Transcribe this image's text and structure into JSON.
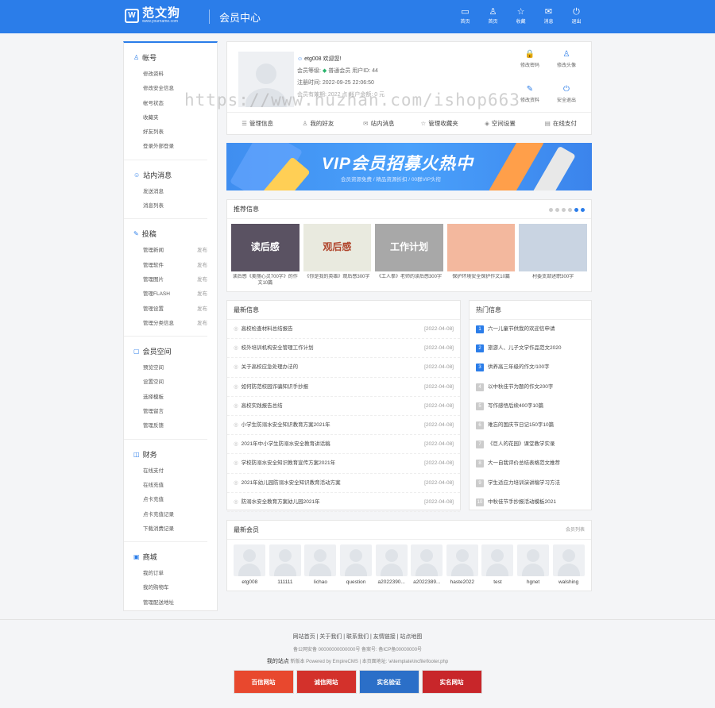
{
  "header": {
    "logo_mark": "W",
    "site_name": "范文狗",
    "site_url": "www.yourname.com",
    "page_title": "会员中心",
    "nav": [
      {
        "icon": "monitor-icon",
        "glyph": "▭",
        "label": "首页"
      },
      {
        "icon": "user-icon",
        "glyph": "♙",
        "label": "首页"
      },
      {
        "icon": "star-icon",
        "glyph": "☆",
        "label": "收藏"
      },
      {
        "icon": "mail-icon",
        "glyph": "✉",
        "label": "消息"
      },
      {
        "icon": "power-icon",
        "glyph": "⏻",
        "label": "退出"
      }
    ]
  },
  "sidebar": [
    {
      "title": "帐号",
      "icon": "user-icon",
      "glyph": "♙",
      "items": [
        {
          "label": "修改资料",
          "action": ""
        },
        {
          "label": "修改安全信息",
          "action": ""
        },
        {
          "label": "帐号状态",
          "action": ""
        },
        {
          "label": "收藏夹",
          "action": ""
        },
        {
          "label": "好友列表",
          "action": ""
        },
        {
          "label": "登录外部登录",
          "action": ""
        }
      ]
    },
    {
      "title": "站内消息",
      "icon": "message-icon",
      "glyph": "☺",
      "items": [
        {
          "label": "发送消息",
          "action": ""
        },
        {
          "label": "消息列表",
          "action": ""
        }
      ]
    },
    {
      "title": "投稿",
      "icon": "pen-icon",
      "glyph": "✎",
      "items": [
        {
          "label": "管理新闻",
          "action": "发布"
        },
        {
          "label": "管理软件",
          "action": "发布"
        },
        {
          "label": "管理图片",
          "action": "发布"
        },
        {
          "label": "管理FLASH",
          "action": "发布"
        },
        {
          "label": "管理设置",
          "action": "发布"
        },
        {
          "label": "管理分类信息",
          "action": "发布"
        }
      ]
    },
    {
      "title": "会员空间",
      "icon": "space-icon",
      "glyph": "▢",
      "items": [
        {
          "label": "预览空间",
          "action": ""
        },
        {
          "label": "设置空间",
          "action": ""
        },
        {
          "label": "选择模板",
          "action": ""
        },
        {
          "label": "管理留言",
          "action": ""
        },
        {
          "label": "管理反馈",
          "action": ""
        }
      ]
    },
    {
      "title": "财务",
      "icon": "wallet-icon",
      "glyph": "◫",
      "items": [
        {
          "label": "在线支付",
          "action": ""
        },
        {
          "label": "在线充值",
          "action": ""
        },
        {
          "label": "点卡充值",
          "action": ""
        },
        {
          "label": "点卡充值记录",
          "action": ""
        },
        {
          "label": "下载消费记录",
          "action": ""
        }
      ]
    },
    {
      "title": "商城",
      "icon": "shop-icon",
      "glyph": "▣",
      "items": [
        {
          "label": "我的订单",
          "action": ""
        },
        {
          "label": "我的购物车",
          "action": ""
        },
        {
          "label": "管理配送地址",
          "action": ""
        }
      ]
    }
  ],
  "profile": {
    "username": "etg008 欢迎您!",
    "level_label": "会员等级:",
    "level": "普通会员",
    "uid": "用户ID: 44",
    "reg_time": "注册时间: 2022-09-25 22:06:50",
    "extra": "会员有效期: 2022 点  帐户余额: 0 元",
    "actions": [
      {
        "icon": "lock-icon",
        "glyph": "🔒",
        "label": "修改密码"
      },
      {
        "icon": "user-edit-icon",
        "glyph": "♙",
        "label": "修改头像"
      },
      {
        "icon": "edit-icon",
        "glyph": "✎",
        "label": "修改资料"
      },
      {
        "icon": "logout-icon",
        "glyph": "⏻",
        "label": "安全退出"
      }
    ],
    "tabs": [
      {
        "icon": "list-icon",
        "glyph": "☰",
        "label": "管理信息"
      },
      {
        "icon": "friends-icon",
        "glyph": "♙",
        "label": "我的好友"
      },
      {
        "icon": "inbox-icon",
        "glyph": "✉",
        "label": "站内消息"
      },
      {
        "icon": "favorite-icon",
        "glyph": "☆",
        "label": "管理收藏夹"
      },
      {
        "icon": "cube-icon",
        "glyph": "◈",
        "label": "空间设置"
      },
      {
        "icon": "cart-icon",
        "glyph": "▤",
        "label": "在线支付"
      }
    ]
  },
  "banner": {
    "title": "VIP会员招募火热中",
    "subtitle": "会员资源免费 / 精品资源折扣 / 00群VIP头衔"
  },
  "recommend": {
    "title": "推荐信息",
    "items": [
      {
        "img_text": "读后感",
        "caption": "读后感《美丽心灵700字》的作文10篇",
        "bg": "#5a5262",
        "fg": "#fff"
      },
      {
        "img_text": "观后感",
        "caption": "《你是我的英雄》观后感300字",
        "bg": "#e9eadf",
        "fg": "#b0452c"
      },
      {
        "img_text": "工作计划",
        "caption": "《工人拳》老师的读后感300字",
        "bg": "#a8a8a8",
        "fg": "#fff"
      },
      {
        "img_text": "",
        "caption": "保护环境安全保护作文10篇",
        "bg": "#f3b89e",
        "fg": "#fff"
      },
      {
        "img_text": "",
        "caption": "村委支部述职300字",
        "bg": "#c9d4e2",
        "fg": "#fff"
      }
    ]
  },
  "latest": {
    "title": "最新信息",
    "items": [
      {
        "t": "高校检查材料总结报告",
        "d": "[2022-04-08]"
      },
      {
        "t": "校外培训机构安全管理工作计划",
        "d": "[2022-04-08]"
      },
      {
        "t": "关于高校应急处理办法的",
        "d": "[2022-04-08]"
      },
      {
        "t": "如何防范校园诈骗知识手抄报",
        "d": "[2022-04-08]"
      },
      {
        "t": "高校实践报告总结",
        "d": "[2022-04-08]"
      },
      {
        "t": "小学生防溺水安全知识教育方案2021年",
        "d": "[2022-04-08]"
      },
      {
        "t": "2021年中小学生防溺水安全教育讲话稿",
        "d": "[2022-04-08]"
      },
      {
        "t": "学校防溺水安全知识教育宣传方案2021年",
        "d": "[2022-04-08]"
      },
      {
        "t": "2021年幼儿园防溺水安全知识教育活动方案",
        "d": "[2022-04-08]"
      },
      {
        "t": "防溺水安全教育方案幼儿园2021年",
        "d": "[2022-04-08]"
      }
    ]
  },
  "hot": {
    "title": "热门信息",
    "items": [
      {
        "n": "1",
        "t": "六一儿童节供我的欢迎信申请"
      },
      {
        "n": "2",
        "t": "旅游人、儿子文学作品范文2020"
      },
      {
        "n": "3",
        "t": "供养高三年级的作文/100字"
      },
      {
        "n": "4",
        "t": "以中秋佳节为题的作文200字"
      },
      {
        "n": "5",
        "t": "写作感悟后续400字10篇"
      },
      {
        "n": "6",
        "t": "难忘的国庆节日记150字10篇"
      },
      {
        "n": "7",
        "t": "《巨人的花园》课堂教学实录"
      },
      {
        "n": "8",
        "t": "大一自我评价总结表格范文推荐"
      },
      {
        "n": "9",
        "t": "学生适应力培训演讲稿学习方法"
      },
      {
        "n": "10",
        "t": "中秋佳节手抄报活动模板2021"
      }
    ]
  },
  "recent_members": {
    "title": "最新会员",
    "more": "会员列表",
    "items": [
      "etg008",
      "111111",
      "lichao",
      "question",
      "a2022390...",
      "a2022389...",
      "haste2022",
      "test",
      "hgnet",
      "walshing"
    ]
  },
  "footer": {
    "links": "网站首页 | 关于我们 | 联系我们 | 友情链接 | 站点地图",
    "line1": "备公网安备 00000000000000号  备案号: 备ICP备00000000号",
    "line2_bold": "我的站点",
    "line2": " 新版本 Powered by EmpireCMS | 本页面地址: \\e\\template\\incfile\\footer.php",
    "badges": [
      {
        "label": "百信网站",
        "bg": "#e8482e"
      },
      {
        "label": "诚信网站",
        "bg": "#d3312b"
      },
      {
        "label": "实名验证",
        "bg": "#2b6fc8"
      },
      {
        "label": "实名网站",
        "bg": "#c8262a"
      }
    ]
  },
  "watermark": "https://www.huzhan.com/ishop663"
}
